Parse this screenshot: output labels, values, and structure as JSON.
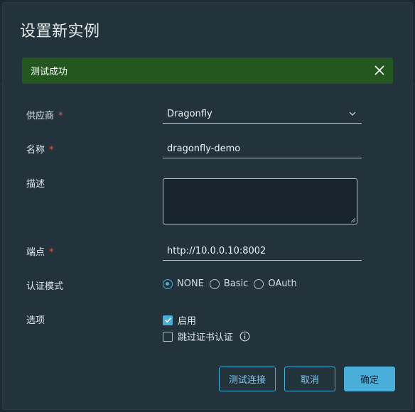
{
  "dialog": {
    "title": "设置新实例"
  },
  "alert": {
    "message": "测试成功",
    "status_color": "#23571f"
  },
  "form": {
    "provider": {
      "label": "供应商",
      "required_mark": "*",
      "value": "Dragonfly"
    },
    "name": {
      "label": "名称",
      "required_mark": "*",
      "value": "dragonfly-demo"
    },
    "description": {
      "label": "描述",
      "value": ""
    },
    "endpoint": {
      "label": "端点",
      "required_mark": "*",
      "value": "http://10.0.0.10:8002"
    },
    "auth_mode": {
      "label": "认证模式",
      "options": [
        {
          "label": "NONE",
          "selected": true
        },
        {
          "label": "Basic",
          "selected": false
        },
        {
          "label": "OAuth",
          "selected": false
        }
      ]
    },
    "options": {
      "label": "选项",
      "enable": {
        "label": "启用",
        "checked": true
      },
      "skip_cert": {
        "label": "跳过证书认证",
        "checked": false
      }
    }
  },
  "buttons": {
    "test_connection": "测试连接",
    "cancel": "取消",
    "confirm": "确定"
  },
  "colors": {
    "accent": "#49afd9",
    "required": "#e05a4a",
    "panel": "#22333b"
  }
}
